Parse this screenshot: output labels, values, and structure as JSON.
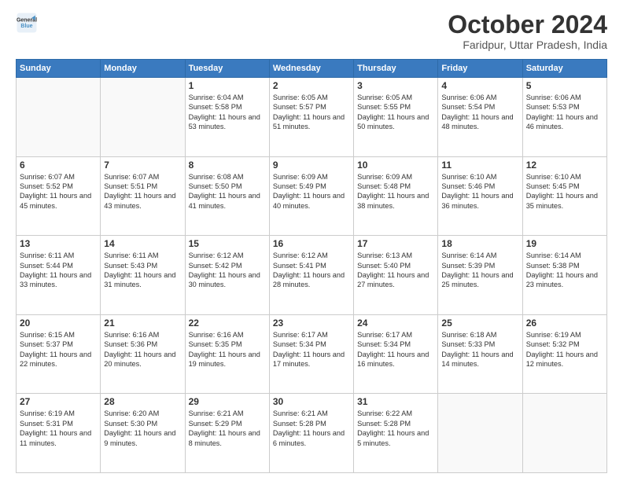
{
  "logo": {
    "line1": "General",
    "line2": "Blue"
  },
  "title": "October 2024",
  "location": "Faridpur, Uttar Pradesh, India",
  "days_of_week": [
    "Sunday",
    "Monday",
    "Tuesday",
    "Wednesday",
    "Thursday",
    "Friday",
    "Saturday"
  ],
  "weeks": [
    [
      {
        "day": "",
        "sunrise": "",
        "sunset": "",
        "daylight": ""
      },
      {
        "day": "",
        "sunrise": "",
        "sunset": "",
        "daylight": ""
      },
      {
        "day": "1",
        "sunrise": "Sunrise: 6:04 AM",
        "sunset": "Sunset: 5:58 PM",
        "daylight": "Daylight: 11 hours and 53 minutes."
      },
      {
        "day": "2",
        "sunrise": "Sunrise: 6:05 AM",
        "sunset": "Sunset: 5:57 PM",
        "daylight": "Daylight: 11 hours and 51 minutes."
      },
      {
        "day": "3",
        "sunrise": "Sunrise: 6:05 AM",
        "sunset": "Sunset: 5:55 PM",
        "daylight": "Daylight: 11 hours and 50 minutes."
      },
      {
        "day": "4",
        "sunrise": "Sunrise: 6:06 AM",
        "sunset": "Sunset: 5:54 PM",
        "daylight": "Daylight: 11 hours and 48 minutes."
      },
      {
        "day": "5",
        "sunrise": "Sunrise: 6:06 AM",
        "sunset": "Sunset: 5:53 PM",
        "daylight": "Daylight: 11 hours and 46 minutes."
      }
    ],
    [
      {
        "day": "6",
        "sunrise": "Sunrise: 6:07 AM",
        "sunset": "Sunset: 5:52 PM",
        "daylight": "Daylight: 11 hours and 45 minutes."
      },
      {
        "day": "7",
        "sunrise": "Sunrise: 6:07 AM",
        "sunset": "Sunset: 5:51 PM",
        "daylight": "Daylight: 11 hours and 43 minutes."
      },
      {
        "day": "8",
        "sunrise": "Sunrise: 6:08 AM",
        "sunset": "Sunset: 5:50 PM",
        "daylight": "Daylight: 11 hours and 41 minutes."
      },
      {
        "day": "9",
        "sunrise": "Sunrise: 6:09 AM",
        "sunset": "Sunset: 5:49 PM",
        "daylight": "Daylight: 11 hours and 40 minutes."
      },
      {
        "day": "10",
        "sunrise": "Sunrise: 6:09 AM",
        "sunset": "Sunset: 5:48 PM",
        "daylight": "Daylight: 11 hours and 38 minutes."
      },
      {
        "day": "11",
        "sunrise": "Sunrise: 6:10 AM",
        "sunset": "Sunset: 5:46 PM",
        "daylight": "Daylight: 11 hours and 36 minutes."
      },
      {
        "day": "12",
        "sunrise": "Sunrise: 6:10 AM",
        "sunset": "Sunset: 5:45 PM",
        "daylight": "Daylight: 11 hours and 35 minutes."
      }
    ],
    [
      {
        "day": "13",
        "sunrise": "Sunrise: 6:11 AM",
        "sunset": "Sunset: 5:44 PM",
        "daylight": "Daylight: 11 hours and 33 minutes."
      },
      {
        "day": "14",
        "sunrise": "Sunrise: 6:11 AM",
        "sunset": "Sunset: 5:43 PM",
        "daylight": "Daylight: 11 hours and 31 minutes."
      },
      {
        "day": "15",
        "sunrise": "Sunrise: 6:12 AM",
        "sunset": "Sunset: 5:42 PM",
        "daylight": "Daylight: 11 hours and 30 minutes."
      },
      {
        "day": "16",
        "sunrise": "Sunrise: 6:12 AM",
        "sunset": "Sunset: 5:41 PM",
        "daylight": "Daylight: 11 hours and 28 minutes."
      },
      {
        "day": "17",
        "sunrise": "Sunrise: 6:13 AM",
        "sunset": "Sunset: 5:40 PM",
        "daylight": "Daylight: 11 hours and 27 minutes."
      },
      {
        "day": "18",
        "sunrise": "Sunrise: 6:14 AM",
        "sunset": "Sunset: 5:39 PM",
        "daylight": "Daylight: 11 hours and 25 minutes."
      },
      {
        "day": "19",
        "sunrise": "Sunrise: 6:14 AM",
        "sunset": "Sunset: 5:38 PM",
        "daylight": "Daylight: 11 hours and 23 minutes."
      }
    ],
    [
      {
        "day": "20",
        "sunrise": "Sunrise: 6:15 AM",
        "sunset": "Sunset: 5:37 PM",
        "daylight": "Daylight: 11 hours and 22 minutes."
      },
      {
        "day": "21",
        "sunrise": "Sunrise: 6:16 AM",
        "sunset": "Sunset: 5:36 PM",
        "daylight": "Daylight: 11 hours and 20 minutes."
      },
      {
        "day": "22",
        "sunrise": "Sunrise: 6:16 AM",
        "sunset": "Sunset: 5:35 PM",
        "daylight": "Daylight: 11 hours and 19 minutes."
      },
      {
        "day": "23",
        "sunrise": "Sunrise: 6:17 AM",
        "sunset": "Sunset: 5:34 PM",
        "daylight": "Daylight: 11 hours and 17 minutes."
      },
      {
        "day": "24",
        "sunrise": "Sunrise: 6:17 AM",
        "sunset": "Sunset: 5:34 PM",
        "daylight": "Daylight: 11 hours and 16 minutes."
      },
      {
        "day": "25",
        "sunrise": "Sunrise: 6:18 AM",
        "sunset": "Sunset: 5:33 PM",
        "daylight": "Daylight: 11 hours and 14 minutes."
      },
      {
        "day": "26",
        "sunrise": "Sunrise: 6:19 AM",
        "sunset": "Sunset: 5:32 PM",
        "daylight": "Daylight: 11 hours and 12 minutes."
      }
    ],
    [
      {
        "day": "27",
        "sunrise": "Sunrise: 6:19 AM",
        "sunset": "Sunset: 5:31 PM",
        "daylight": "Daylight: 11 hours and 11 minutes."
      },
      {
        "day": "28",
        "sunrise": "Sunrise: 6:20 AM",
        "sunset": "Sunset: 5:30 PM",
        "daylight": "Daylight: 11 hours and 9 minutes."
      },
      {
        "day": "29",
        "sunrise": "Sunrise: 6:21 AM",
        "sunset": "Sunset: 5:29 PM",
        "daylight": "Daylight: 11 hours and 8 minutes."
      },
      {
        "day": "30",
        "sunrise": "Sunrise: 6:21 AM",
        "sunset": "Sunset: 5:28 PM",
        "daylight": "Daylight: 11 hours and 6 minutes."
      },
      {
        "day": "31",
        "sunrise": "Sunrise: 6:22 AM",
        "sunset": "Sunset: 5:28 PM",
        "daylight": "Daylight: 11 hours and 5 minutes."
      },
      {
        "day": "",
        "sunrise": "",
        "sunset": "",
        "daylight": ""
      },
      {
        "day": "",
        "sunrise": "",
        "sunset": "",
        "daylight": ""
      }
    ]
  ]
}
